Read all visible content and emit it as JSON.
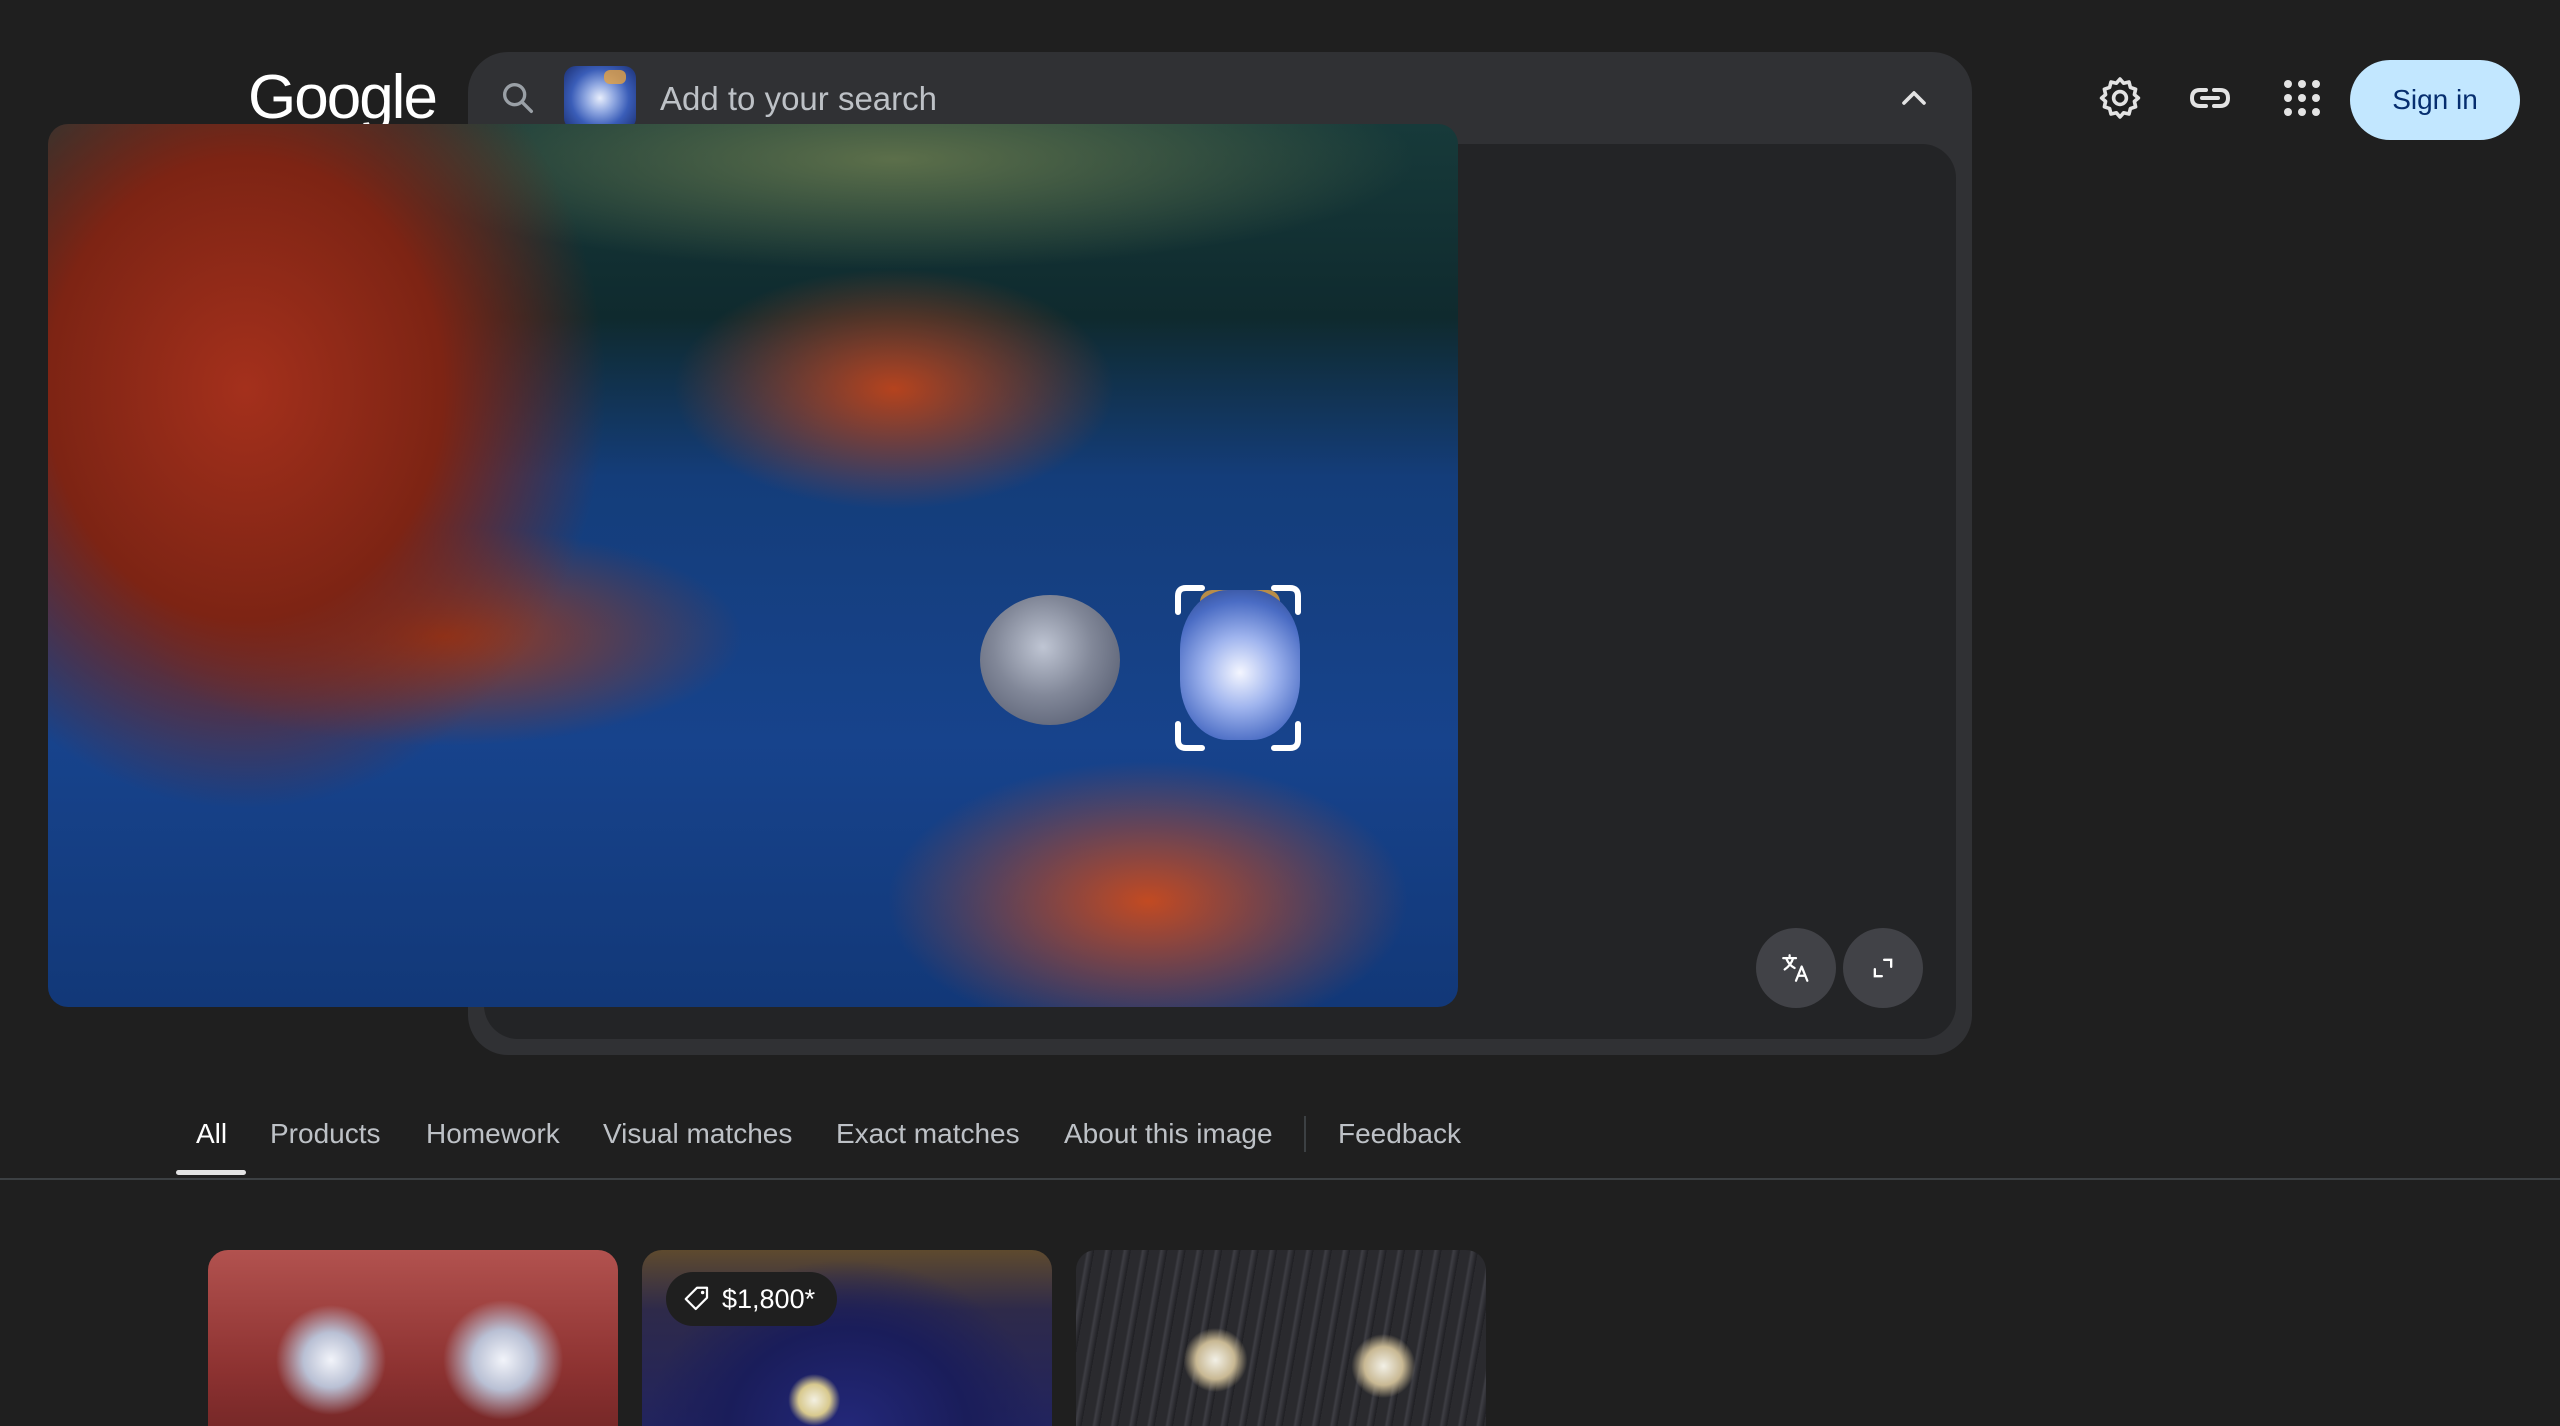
{
  "logo": {
    "text": "Google"
  },
  "search": {
    "placeholder": "Add to your search"
  },
  "header": {
    "sign_in_label": "Sign in"
  },
  "tabs": [
    {
      "label": "All",
      "active": true
    },
    {
      "label": "Products",
      "active": false
    },
    {
      "label": "Homework",
      "active": false
    },
    {
      "label": "Visual matches",
      "active": false
    },
    {
      "label": "Exact matches",
      "active": false
    },
    {
      "label": "About this image",
      "active": false
    },
    {
      "label": "Feedback",
      "active": false
    }
  ],
  "results": [
    {
      "price": ""
    },
    {
      "price": "$1,800*"
    },
    {
      "price": ""
    }
  ],
  "icons": {
    "search": "search-icon",
    "collapse": "chevron-up-icon",
    "translate": "translate-icon",
    "expand": "expand-icon",
    "settings": "gear-icon",
    "link": "link-icon",
    "apps": "apps-grid-icon",
    "price": "price-tag-icon"
  },
  "colors": {
    "background": "#1f1f1f",
    "panel": "#303134",
    "sign_in_bg": "#c2e7ff",
    "sign_in_text": "#062e6f"
  }
}
